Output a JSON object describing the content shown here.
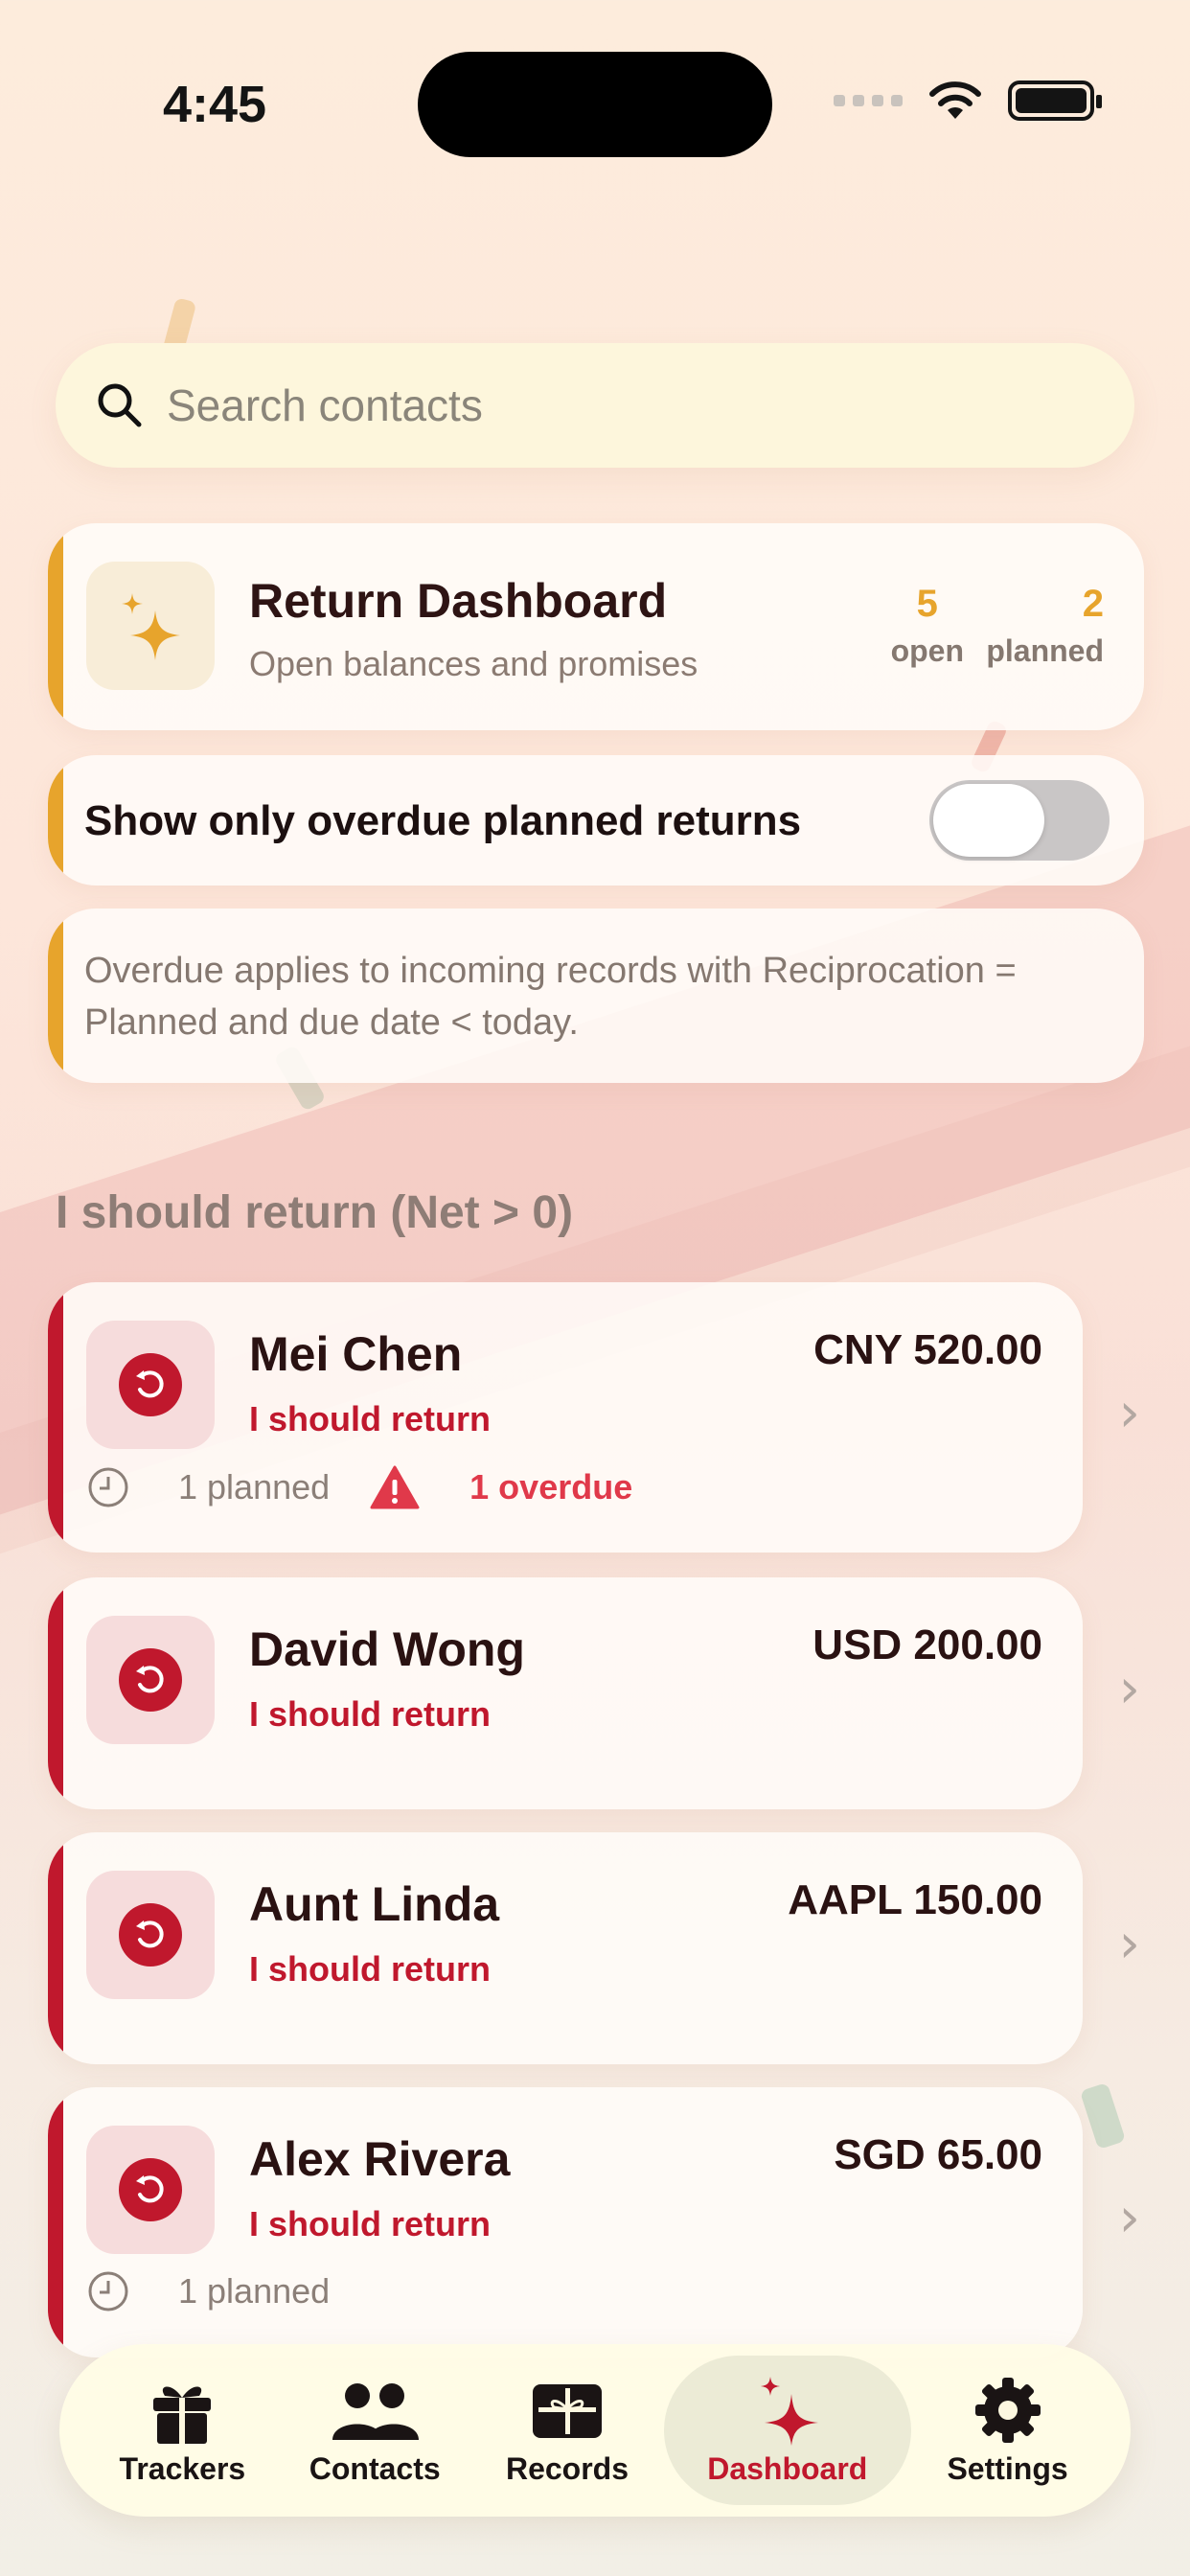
{
  "status_bar": {
    "time": "4:45"
  },
  "search": {
    "placeholder": "Search contacts"
  },
  "dashboard": {
    "title": "Return Dashboard",
    "subtitle": "Open balances and promises",
    "stats": [
      {
        "value": "5",
        "label": "open"
      },
      {
        "value": "2",
        "label": "planned"
      }
    ]
  },
  "filter": {
    "label": "Show only overdue planned returns",
    "enabled": false
  },
  "info": {
    "text": "Overdue applies to incoming records with Reciprocation = Planned and due date < today."
  },
  "section": {
    "title": "I should return (Net > 0)"
  },
  "contacts": [
    {
      "name": "Mei Chen",
      "status": "I should return",
      "amount": "CNY 520.00",
      "planned": "1 planned",
      "overdue": "1 overdue"
    },
    {
      "name": "David Wong",
      "status": "I should return",
      "amount": "USD 200.00"
    },
    {
      "name": "Aunt Linda",
      "status": "I should return",
      "amount": "AAPL 150.00"
    },
    {
      "name": "Alex Rivera",
      "status": "I should return",
      "amount": "SGD 65.00",
      "planned": "1 planned"
    }
  ],
  "tabs": [
    {
      "label": "Trackers",
      "icon": "gift-icon"
    },
    {
      "label": "Contacts",
      "icon": "people-icon"
    },
    {
      "label": "Records",
      "icon": "gift-card-icon"
    },
    {
      "label": "Dashboard",
      "icon": "sparkle-icon",
      "active": true
    },
    {
      "label": "Settings",
      "icon": "gear-icon"
    }
  ],
  "colors": {
    "accent_gold": "#e7a42c",
    "accent_red": "#c0182d",
    "overdue_red": "#e0394a"
  }
}
